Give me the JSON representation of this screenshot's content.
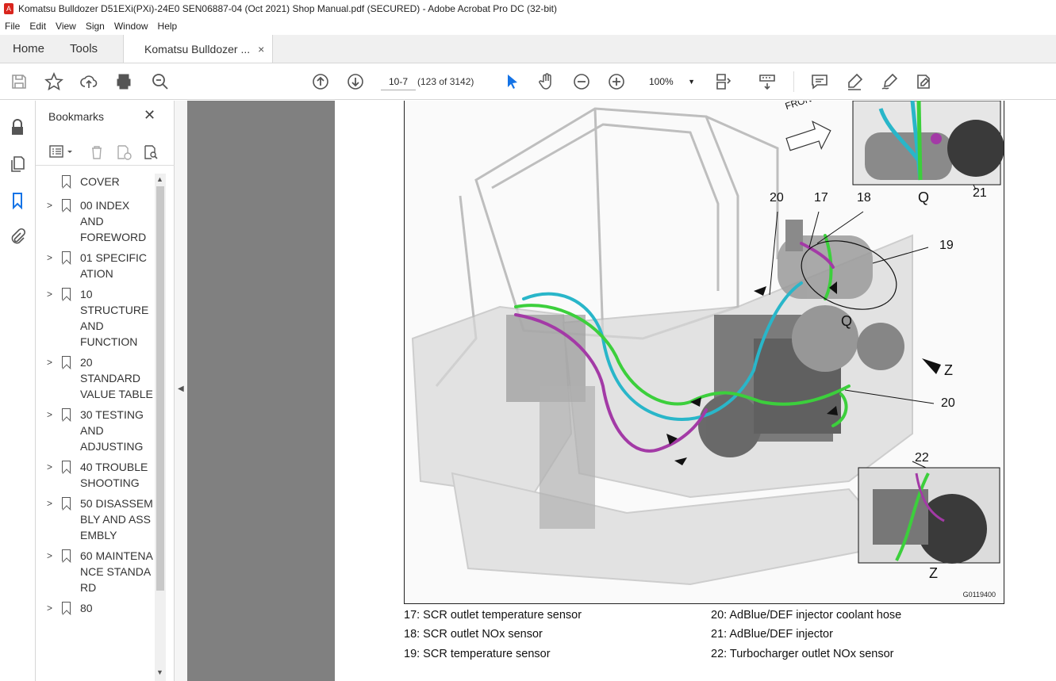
{
  "window": {
    "title": "Komatsu Bulldozer D51EXi(PXi)-24E0 SEN06887-04 (Oct 2021) Shop Manual.pdf (SECURED) - Adobe Acrobat Pro DC (32-bit)"
  },
  "menu": [
    "File",
    "Edit",
    "View",
    "Sign",
    "Window",
    "Help"
  ],
  "tabs": {
    "home": "Home",
    "tools": "Tools",
    "document": "Komatsu Bulldozer ...",
    "close_symbol": "×"
  },
  "toolbar": {
    "page_input": "10-7",
    "page_count": "(123 of 3142)",
    "zoom": "100%"
  },
  "bookmarks": {
    "title": "Bookmarks",
    "close": "✕",
    "items": [
      {
        "label": "COVER",
        "expandable": false
      },
      {
        "label": "00 INDEX AND FOREWORD",
        "expandable": true
      },
      {
        "label": "01 SPECIFICATION",
        "expandable": true
      },
      {
        "label": "10 STRUCTURE AND FUNCTION",
        "expandable": true
      },
      {
        "label": "20 STANDARD VALUE TABLE",
        "expandable": true
      },
      {
        "label": "30 TESTING AND ADJUSTING",
        "expandable": true
      },
      {
        "label": "40 TROUBLESHOOTING",
        "expandable": true
      },
      {
        "label": "50 DISASSEMBLY AND ASSEMBLY",
        "expandable": true
      },
      {
        "label": "60 MAINTENANCE STANDARD",
        "expandable": true
      },
      {
        "label": "80",
        "expandable": true
      }
    ]
  },
  "figure": {
    "code": "G0119400",
    "front_label": "FRONT",
    "callouts": {
      "c17": "17",
      "c18": "18",
      "c19": "19",
      "c20a": "20",
      "c20b": "20",
      "c21": "21",
      "c22": "22",
      "q_main": "Q",
      "q_inset": "Q",
      "z_main": "Z",
      "z_inset": "Z"
    }
  },
  "legend": {
    "l17": "17: SCR outlet temperature sensor",
    "l18": "18: SCR outlet NOx sensor",
    "l19": "19: SCR temperature sensor",
    "l20": "20: AdBlue/DEF injector coolant hose",
    "l21": "21: AdBlue/DEF injector",
    "l22": "22: Turbocharger outlet NOx sensor"
  },
  "colors": {
    "harness_cyan": "#29b6c9",
    "harness_green": "#3ccf3c",
    "harness_magenta": "#a33aa6",
    "viewer_gray": "#808080"
  }
}
